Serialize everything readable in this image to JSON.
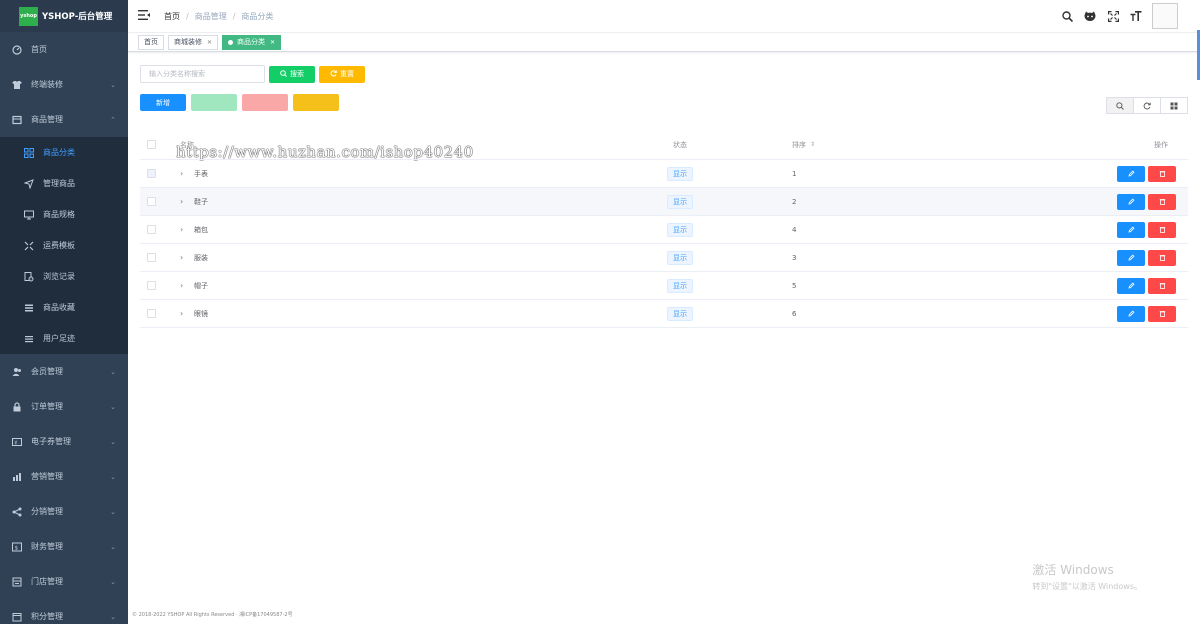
{
  "app": {
    "logo_text": "yshop",
    "title": "YSHOP-后台管理"
  },
  "sidebar": {
    "items": [
      {
        "label": "首页",
        "icon": "dashboard-icon"
      },
      {
        "label": "终端装修",
        "icon": "shirt-icon"
      },
      {
        "label": "商品管理",
        "icon": "product-icon"
      }
    ],
    "submenu": [
      {
        "label": "商品分类",
        "icon": "grid-icon"
      },
      {
        "label": "管理商品",
        "icon": "send-icon"
      },
      {
        "label": "商品规格",
        "icon": "monitor-icon"
      },
      {
        "label": "运费模板",
        "icon": "expand-icon"
      },
      {
        "label": "浏览记录",
        "icon": "history-icon"
      },
      {
        "label": "商品收藏",
        "icon": "list-icon"
      },
      {
        "label": "用户足迹",
        "icon": "menu-icon"
      }
    ],
    "lower_items": [
      {
        "label": "会员管理",
        "icon": "users-icon"
      },
      {
        "label": "订单管理",
        "icon": "lock-icon"
      },
      {
        "label": "电子券管理",
        "icon": "coupon-icon"
      },
      {
        "label": "营销管理",
        "icon": "chart-icon"
      },
      {
        "label": "分销管理",
        "icon": "share-icon"
      },
      {
        "label": "财务管理",
        "icon": "finance-icon"
      },
      {
        "label": "门店管理",
        "icon": "store-icon"
      },
      {
        "label": "积分管理",
        "icon": "points-icon"
      }
    ]
  },
  "header": {
    "breadcrumb": [
      "首页",
      "商品管理",
      "商品分类"
    ]
  },
  "tags": [
    {
      "label": "首页",
      "active": false,
      "closable": false
    },
    {
      "label": "商城装修",
      "active": false,
      "closable": true
    },
    {
      "label": "商品分类",
      "active": true,
      "closable": true
    }
  ],
  "search": {
    "placeholder": "输入分类名称搜索",
    "search_label": "搜索",
    "reset_label": "重置"
  },
  "actions": {
    "add_label": "新增"
  },
  "watermark": "https://www.huzhan.com/ishop40240",
  "table": {
    "headers": {
      "name": "名称",
      "status": "状态",
      "sort": "排序",
      "ops": "操作"
    },
    "rows": [
      {
        "name": "手表",
        "status": "显示",
        "sort": "1"
      },
      {
        "name": "鞋子",
        "status": "显示",
        "sort": "2"
      },
      {
        "name": "箱包",
        "status": "显示",
        "sort": "4"
      },
      {
        "name": "服装",
        "status": "显示",
        "sort": "3"
      },
      {
        "name": "帽子",
        "status": "显示",
        "sort": "5"
      },
      {
        "name": "眼镜",
        "status": "显示",
        "sort": "6"
      }
    ]
  },
  "footer": "© 2018-2022 YSHOP All Rights Reserved · 湘ICP备17049587-2号",
  "windows": {
    "line1": "激活 Windows",
    "line2": "转到\"设置\"以激活 Windows。"
  },
  "colors": {
    "sidebar_bg": "#304156",
    "active_blue": "#409eff",
    "tag_active": "#42b983",
    "search_green": "#13ce66",
    "reset_yellow": "#ffba00",
    "delete_red": "#ff4949"
  }
}
